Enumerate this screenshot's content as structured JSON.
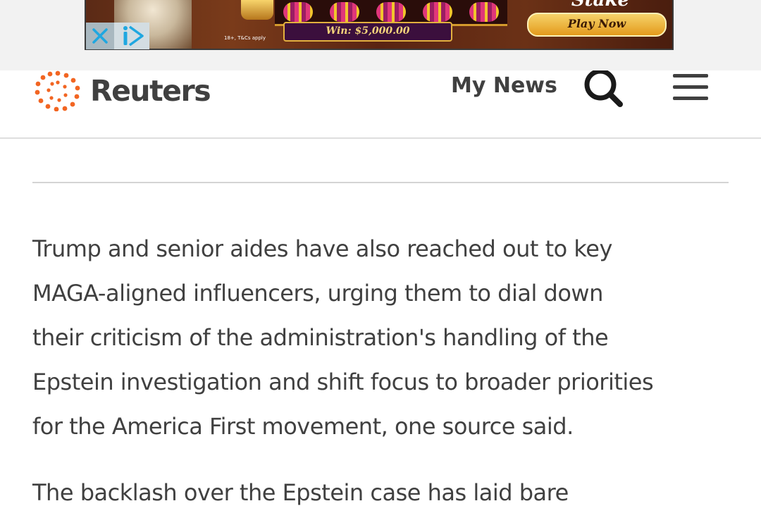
{
  "ad": {
    "win_text": "Win: $5,000.00",
    "play_label": "Play Now",
    "fine_print": "18+, T&Cs apply",
    "close_icon": "close-x-icon",
    "info_icon": "adchoices-icon"
  },
  "header": {
    "logo_text": "Reuters",
    "my_news_label": "My News",
    "search_icon": "search-icon",
    "menu_icon": "hamburger-menu-icon",
    "brand_color": "#f26522"
  },
  "article": {
    "paragraphs": [
      {
        "lines": [
          "Trump and senior aides have also reached out to key",
          "MAGA-aligned influencers, urging them to dial down",
          "their criticism of the administration's handling of the",
          "Epstein investigation and shift focus to broader priorities",
          "for the America First movement, one source said."
        ]
      },
      {
        "lines": [
          "The backlash over the Epstein case has laid bare"
        ]
      }
    ]
  }
}
